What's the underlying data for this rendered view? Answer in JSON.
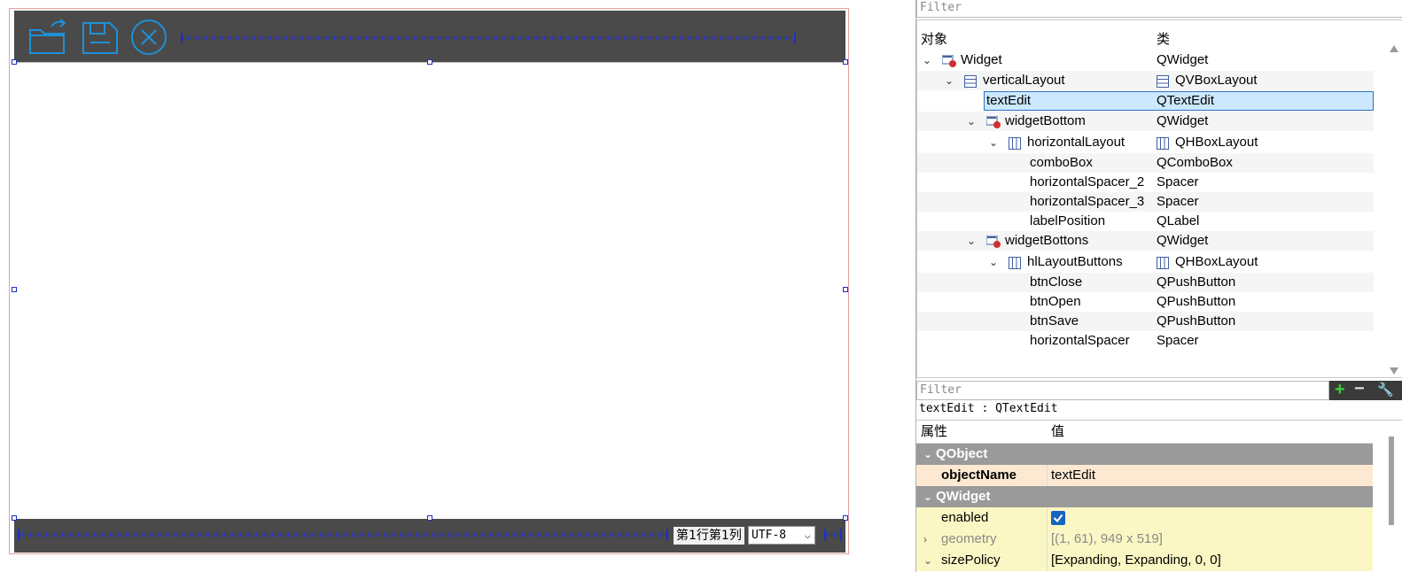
{
  "form": {
    "toolbar_icons": [
      "open-folder-icon",
      "save-icon",
      "close-circle-icon"
    ],
    "position_label": "第1行第1列",
    "encoding": "UTF-8"
  },
  "object_inspector": {
    "filter_placeholder": "Filter",
    "col_object": "对象",
    "col_class": "类",
    "rows": [
      {
        "name": "Widget",
        "class": "QWidget"
      },
      {
        "name": "verticalLayout",
        "class": "QVBoxLayout"
      },
      {
        "name": "textEdit",
        "class": "QTextEdit"
      },
      {
        "name": "widgetBottom",
        "class": "QWidget"
      },
      {
        "name": "horizontalLayout",
        "class": "QHBoxLayout"
      },
      {
        "name": "comboBox",
        "class": "QComboBox"
      },
      {
        "name": "horizontalSpacer_2",
        "class": "Spacer"
      },
      {
        "name": "horizontalSpacer_3",
        "class": "Spacer"
      },
      {
        "name": "labelPosition",
        "class": "QLabel"
      },
      {
        "name": "widgetBottons",
        "class": "QWidget"
      },
      {
        "name": "hlLayoutButtons",
        "class": "QHBoxLayout"
      },
      {
        "name": "btnClose",
        "class": "QPushButton"
      },
      {
        "name": "btnOpen",
        "class": "QPushButton"
      },
      {
        "name": "btnSave",
        "class": "QPushButton"
      },
      {
        "name": "horizontalSpacer",
        "class": "Spacer"
      }
    ],
    "selected": "textEdit"
  },
  "property_editor": {
    "filter_placeholder": "Filter",
    "title": "textEdit : QTextEdit",
    "col_property": "属性",
    "col_value": "值",
    "groups": {
      "qobject": "QObject",
      "qwidget": "QWidget"
    },
    "props": {
      "objectName": {
        "name": "objectName",
        "value": "textEdit"
      },
      "enabled": {
        "name": "enabled",
        "checked": true
      },
      "geometry": {
        "name": "geometry",
        "value": "[(1, 61), 949 x 519]"
      },
      "sizePolicy": {
        "name": "sizePolicy",
        "value": "[Expanding, Expanding, 0, 0]"
      }
    }
  },
  "colors": {
    "designer_dark": "#4a4a4a",
    "icon_blue": "#1e90d8",
    "selection": "#cce8ff",
    "qobject_row": "#fde9d2",
    "qwidget_row": "#fbf7c4",
    "group_row": "#9a9a9a"
  }
}
